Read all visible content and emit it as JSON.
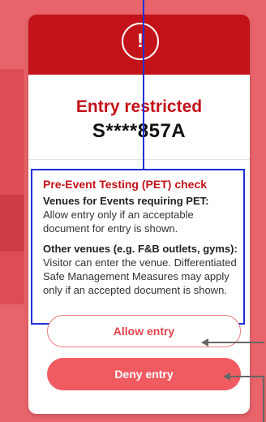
{
  "dialog": {
    "alert_glyph": "!",
    "title": "Entry restricted",
    "masked_id": "S****857A"
  },
  "pet": {
    "heading": "Pre-Event Testing (PET) check",
    "section1_title": "Venues for Events requiring PET:",
    "section1_text": "Allow entry only if an acceptable document for entry is shown.",
    "section2_title": "Other venues (e.g. F&B outlets, gyms):",
    "section2_text": "Visitor can enter the venue. Differentiated Safe Management Measures may apply only if an accepted document is shown."
  },
  "actions": {
    "allow_label": "Allow entry",
    "deny_label": "Deny entry"
  },
  "colors": {
    "background": "#e8646a",
    "header": "#c3121a",
    "accent": "#f05a61",
    "annotation_box": "#1f2fd6"
  },
  "icons": {
    "alert": "exclamation-circle-icon"
  }
}
